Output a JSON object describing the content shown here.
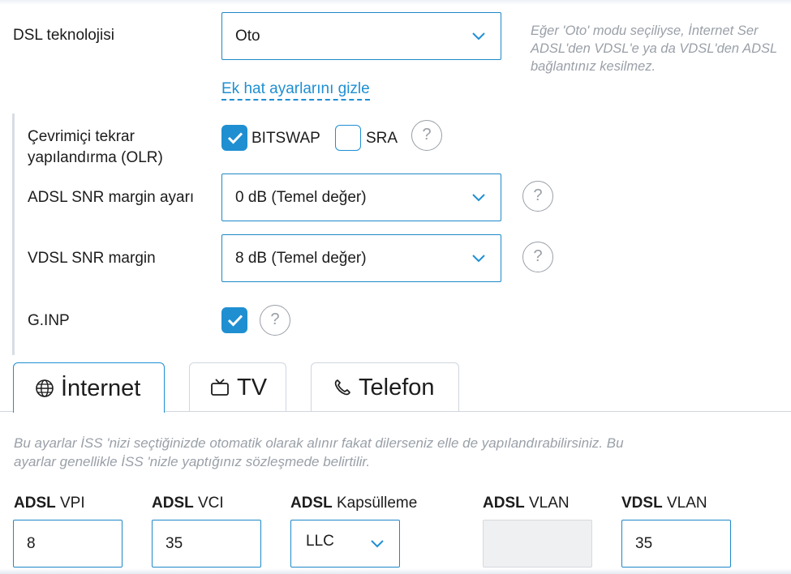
{
  "dsl": {
    "label": "DSL teknolojisi",
    "value": "Oto",
    "hint_line1": "Eğer 'Oto' modu seçiliyse, İnternet Ser",
    "hint_line2": "ADSL'den VDSL'e ya da VDSL'den ADSL",
    "hint_line3": "bağlantınız kesilmez.",
    "toggle_link": "Ek hat ayarlarını gizle"
  },
  "olr": {
    "label_line1": "Çevrimiçi tekrar",
    "label_line2": "yapılandırma (OLR)",
    "bitswap_label": "BITSWAP",
    "bitswap_checked": true,
    "sra_label": "SRA",
    "sra_checked": false
  },
  "adsl_snr": {
    "label": "ADSL SNR margin ayarı",
    "value": "0 dB (Temel değer)"
  },
  "vdsl_snr": {
    "label": "VDSL SNR margin",
    "value": "8 dB (Temel değer)"
  },
  "ginp": {
    "label": "G.INP",
    "checked": true
  },
  "help_symbol": "?",
  "tabs": [
    {
      "label": "İnternet",
      "icon": "globe-icon",
      "active": true
    },
    {
      "label": "TV",
      "icon": "tv-icon",
      "active": false
    },
    {
      "label": "Telefon",
      "icon": "phone-icon",
      "active": false
    }
  ],
  "info_line1": "Bu ayarlar İSS 'nizi seçtiğinizde otomatik olarak alınır fakat dilerseniz elle de yapılandırabilirsiniz. Bu",
  "info_line2": "ayarlar genellikle İSS 'nizle yaptığınız sözleşmede belirtilir.",
  "fields": {
    "vpi": {
      "prefix": "ADSL",
      "label": " VPI",
      "value": "8"
    },
    "vci": {
      "prefix": "ADSL",
      "label": " VCI",
      "value": "35"
    },
    "encap": {
      "prefix": "ADSL",
      "label": " Kapsülleme",
      "value": "LLC"
    },
    "adsl_vlan": {
      "prefix": "ADSL",
      "label": " VLAN",
      "value": ""
    },
    "vdsl_vlan": {
      "prefix": "VDSL",
      "label": " VLAN",
      "value": "35"
    }
  },
  "colors": {
    "accent": "#1f8fd2",
    "border": "#1e88c8",
    "muted": "#9aa0a8"
  }
}
